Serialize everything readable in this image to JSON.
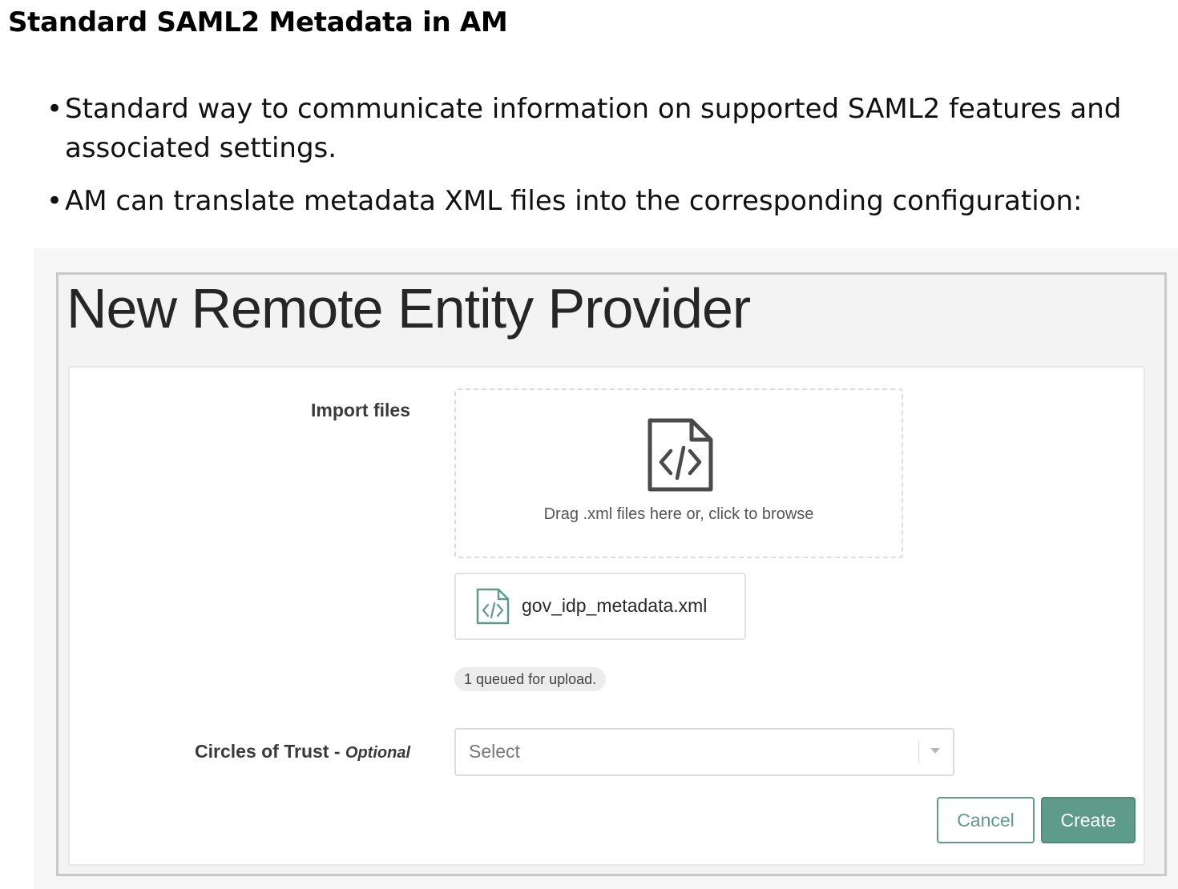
{
  "slide": {
    "title": "Standard SAML2 Metadata in AM",
    "bullets": [
      "Standard way to communicate information on supported SAML2 features and associated settings.",
      "AM can translate metadata XML files into the corresponding configuration:"
    ],
    "bullet_char": "•"
  },
  "dialog": {
    "heading": "New Remote Entity Provider",
    "import": {
      "label": "Import files",
      "dropzone_icon": "xml-file-icon",
      "dropzone_text": "Drag .xml files here or, click to browse",
      "file_icon": "xml-file-icon",
      "file_name": "gov_idp_metadata.xml",
      "queue_status": "1 queued for upload."
    },
    "circles_of_trust": {
      "label": "Circles of Trust - ",
      "optional": "Optional",
      "placeholder": "Select"
    },
    "buttons": {
      "cancel": "Cancel",
      "create": "Create"
    },
    "colors": {
      "accent": "#5e9b8a",
      "icon_dark": "#4a4a4a"
    }
  }
}
